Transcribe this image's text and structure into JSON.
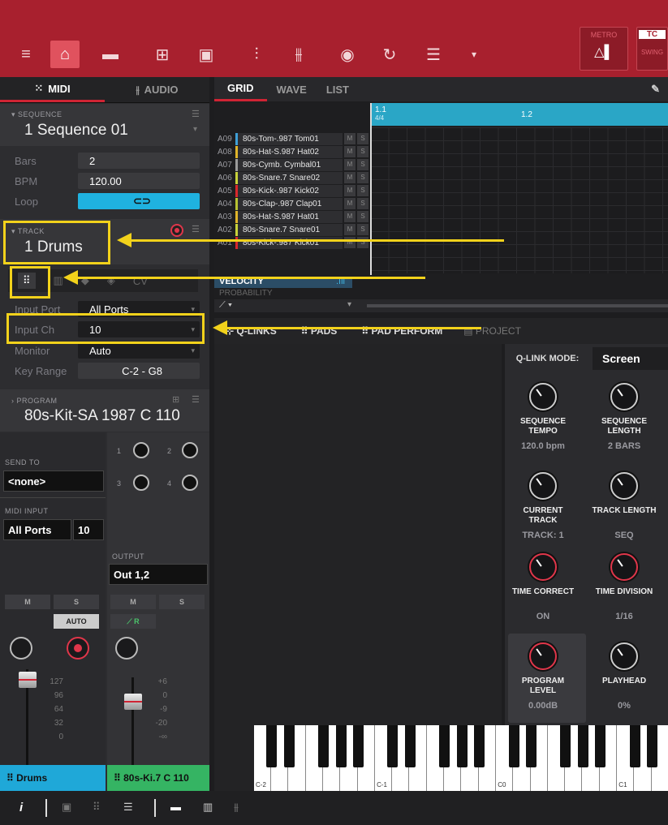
{
  "topbar": {
    "metro_label": "METRO",
    "tc_label": "TC",
    "swing_label": "SWING"
  },
  "left_tabs": {
    "midi": "MIDI",
    "audio": "AUDIO"
  },
  "sequence": {
    "label": "SEQUENCE",
    "name": "1 Sequence 01",
    "bars_label": "Bars",
    "bars": "2",
    "bpm_label": "BPM",
    "bpm": "120.00",
    "loop_label": "Loop"
  },
  "track": {
    "label": "TRACK",
    "name": "1 Drums",
    "input_port_label": "Input Port",
    "input_port": "All Ports",
    "input_ch_label": "Input Ch",
    "input_ch": "10",
    "monitor_label": "Monitor",
    "monitor": "Auto",
    "key_range_label": "Key Range",
    "key_range": "C-2 - G8"
  },
  "program": {
    "label": "PROGRAM",
    "name": "80s-Kit-SA 1987 C 110"
  },
  "mixer": {
    "send_to": "SEND TO",
    "send_value": "<none>",
    "midi_input": "MIDI INPUT",
    "midi_port": "All Ports",
    "midi_ch": "10",
    "output_label": "OUTPUT",
    "output": "Out 1,2",
    "m": "M",
    "s": "S",
    "auto": "AUTO",
    "r": "R",
    "sends": [
      "1",
      "2",
      "3",
      "4"
    ],
    "scale_left": [
      "127",
      "96",
      "64",
      "32",
      "0"
    ],
    "scale_right": [
      "+6",
      "0",
      "-9",
      "-20",
      "-∞"
    ],
    "ch1": "Drums",
    "ch2": "80s-Ki.7 C 110"
  },
  "grid": {
    "tabs": [
      "GRID",
      "WAVE",
      "LIST"
    ],
    "bar1": "1.1",
    "sig": "4/4",
    "bar2": "1.2",
    "velocity": "VELOCITY",
    "probability": "PROBABILITY",
    "tracks": [
      {
        "n": "A09",
        "name": "80s-Tom-.987 Tom01",
        "color": "#3f9fd6"
      },
      {
        "n": "A08",
        "name": "80s-Hat-S.987 Hat02",
        "color": "#e0b52a"
      },
      {
        "n": "A07",
        "name": "80s-Cymb. Cymbal01",
        "color": "#9b9b9b"
      },
      {
        "n": "A06",
        "name": "80s-Snare.7 Snare02",
        "color": "#c8d23a"
      },
      {
        "n": "A05",
        "name": "80s-Kick-.987 Kick02",
        "color": "#d8282c"
      },
      {
        "n": "A04",
        "name": "80s-Clap-.987 Clap01",
        "color": "#b8c232"
      },
      {
        "n": "A03",
        "name": "80s-Hat-S.987 Hat01",
        "color": "#e0b52a"
      },
      {
        "n": "A02",
        "name": "80s-Snare.7 Snare01",
        "color": "#c8d23a"
      },
      {
        "n": "A01",
        "name": "80s-Kick-.987 Kick01",
        "color": "#d8282c"
      }
    ],
    "ms": [
      "M",
      "S"
    ]
  },
  "qtabs": [
    "Q-LINKS",
    "PADS",
    "PAD PERFORM",
    "PROJECT"
  ],
  "qlink": {
    "mode_label": "Q-LINK MODE:",
    "mode": "Screen",
    "knobs": [
      {
        "l1": "SEQUENCE",
        "l2": "TEMPO",
        "val": "120.0 bpm"
      },
      {
        "l1": "SEQUENCE",
        "l2": "LENGTH",
        "val": "2 BARS"
      },
      {
        "l1": "CURRENT",
        "l2": "TRACK",
        "val": "TRACK: 1"
      },
      {
        "l1": "TRACK LENGTH",
        "l2": "",
        "val": "SEQ"
      },
      {
        "l1": "TIME CORRECT",
        "l2": "",
        "val": "ON"
      },
      {
        "l1": "TIME DIVISION",
        "l2": "",
        "val": "1/16"
      },
      {
        "l1": "PROGRAM",
        "l2": "LEVEL",
        "val": "0.00dB"
      },
      {
        "l1": "PLAYHEAD",
        "l2": "",
        "val": "0%"
      }
    ]
  },
  "keyboard": {
    "c_2": "C-2",
    "c_1": "C-1",
    "c0": "C0",
    "c1": "C1"
  }
}
